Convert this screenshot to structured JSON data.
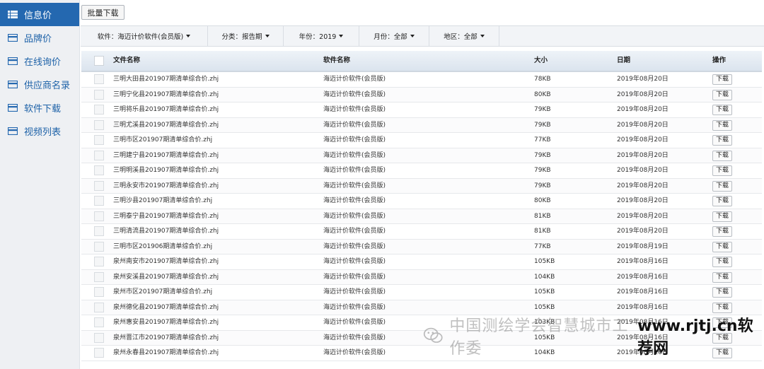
{
  "sidebar": {
    "items": [
      {
        "label": "信息价",
        "icon": "list-icon",
        "active": true
      },
      {
        "label": "品牌价",
        "icon": "card-icon",
        "active": false
      },
      {
        "label": "在线询价",
        "icon": "card-icon",
        "active": false
      },
      {
        "label": "供应商名录",
        "icon": "card-icon",
        "active": false
      },
      {
        "label": "软件下载",
        "icon": "card-icon",
        "active": false
      },
      {
        "label": "视频列表",
        "icon": "card-icon",
        "active": false
      }
    ]
  },
  "toolbar": {
    "batch_download_label": "批量下载"
  },
  "filters": [
    {
      "label": "软件：海迈计价软件(会员版)"
    },
    {
      "label": "分类：报告期"
    },
    {
      "label": "年份：2019"
    },
    {
      "label": "月份：全部"
    },
    {
      "label": "地区：全部"
    }
  ],
  "table": {
    "columns": [
      "文件名称",
      "软件名称",
      "大小",
      "日期",
      "操作"
    ],
    "download_label": "下载",
    "rows": [
      {
        "file": "三明大田县201907期清单综合价.zhj",
        "software": "海迈计价软件(会员版)",
        "size": "78KB",
        "date": "2019年08月20日"
      },
      {
        "file": "三明宁化县201907期清单综合价.zhj",
        "software": "海迈计价软件(会员版)",
        "size": "80KB",
        "date": "2019年08月20日"
      },
      {
        "file": "三明将乐县201907期清单综合价.zhj",
        "software": "海迈计价软件(会员版)",
        "size": "79KB",
        "date": "2019年08月20日"
      },
      {
        "file": "三明尤溪县201907期清单综合价.zhj",
        "software": "海迈计价软件(会员版)",
        "size": "79KB",
        "date": "2019年08月20日"
      },
      {
        "file": "三明市区201907期清单综合价.zhj",
        "software": "海迈计价软件(会员版)",
        "size": "77KB",
        "date": "2019年08月20日"
      },
      {
        "file": "三明建宁县201907期清单综合价.zhj",
        "software": "海迈计价软件(会员版)",
        "size": "79KB",
        "date": "2019年08月20日"
      },
      {
        "file": "三明明溪县201907期清单综合价.zhj",
        "software": "海迈计价软件(会员版)",
        "size": "79KB",
        "date": "2019年08月20日"
      },
      {
        "file": "三明永安市201907期清单综合价.zhj",
        "software": "海迈计价软件(会员版)",
        "size": "79KB",
        "date": "2019年08月20日"
      },
      {
        "file": "三明沙县201907期清单综合价.zhj",
        "software": "海迈计价软件(会员版)",
        "size": "80KB",
        "date": "2019年08月20日"
      },
      {
        "file": "三明泰宁县201907期清单综合价.zhj",
        "software": "海迈计价软件(会员版)",
        "size": "81KB",
        "date": "2019年08月20日"
      },
      {
        "file": "三明清流县201907期清单综合价.zhj",
        "software": "海迈计价软件(会员版)",
        "size": "81KB",
        "date": "2019年08月20日"
      },
      {
        "file": "三明市区201906期清单综合价.zhj",
        "software": "海迈计价软件(会员版)",
        "size": "77KB",
        "date": "2019年08月19日"
      },
      {
        "file": "泉州南安市201907期清单综合价.zhj",
        "software": "海迈计价软件(会员版)",
        "size": "105KB",
        "date": "2019年08月16日"
      },
      {
        "file": "泉州安溪县201907期清单综合价.zhj",
        "software": "海迈计价软件(会员版)",
        "size": "104KB",
        "date": "2019年08月16日"
      },
      {
        "file": "泉州市区201907期清单综合价.zhj",
        "software": "海迈计价软件(会员版)",
        "size": "105KB",
        "date": "2019年08月16日"
      },
      {
        "file": "泉州德化县201907期清单综合价.zhj",
        "software": "海迈计价软件(会员版)",
        "size": "105KB",
        "date": "2019年08月16日"
      },
      {
        "file": "泉州惠安县201907期清单综合价.zhj",
        "software": "海迈计价软件(会员版)",
        "size": "103KB",
        "date": "2019年08月16日"
      },
      {
        "file": "泉州晋江市201907期清单综合价.zhj",
        "software": "海迈计价软件(会员版)",
        "size": "105KB",
        "date": "2019年08月16日"
      },
      {
        "file": "泉州永春县201907期清单综合价.zhj",
        "software": "海迈计价软件(会员版)",
        "size": "104KB",
        "date": "2019年08月16日"
      }
    ]
  },
  "watermark": {
    "text": "中国测绘学会智慧城市工作委",
    "site": "www.rjtj.cn软荐网"
  }
}
